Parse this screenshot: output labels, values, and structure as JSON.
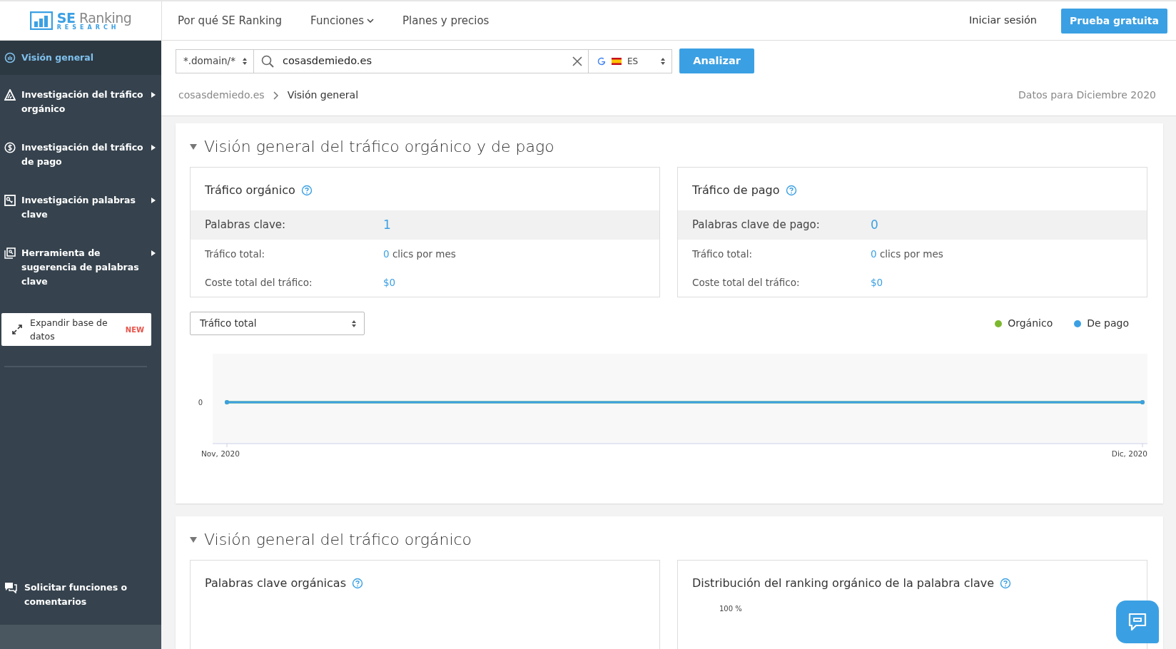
{
  "logo": {
    "name": "SE Ranking",
    "sub": "RESEARCH"
  },
  "sidebar": {
    "items": [
      {
        "label": "Visión general",
        "selected": true,
        "expandable": false
      },
      {
        "label": "Investigación del tráfico orgánico",
        "selected": false,
        "expandable": true
      },
      {
        "label": "Investigación del tráfico de pago",
        "selected": false,
        "expandable": true
      },
      {
        "label": "Investigación palabras clave",
        "selected": false,
        "expandable": true
      },
      {
        "label": "Herramienta de sugerencia de palabras clave",
        "selected": false,
        "expandable": true
      }
    ],
    "expand_button": {
      "label": "Expandir base de datos",
      "badge": "NEW"
    },
    "feedback": "Solicitar funciones o comentarios"
  },
  "nav": {
    "links": [
      {
        "label": "Por qué SE Ranking",
        "dropdown": false
      },
      {
        "label": "Funciones",
        "dropdown": true
      },
      {
        "label": "Planes y precios",
        "dropdown": false
      }
    ],
    "login": "Iniciar sesión",
    "trial": "Prueba gratuita"
  },
  "search": {
    "mode": "*.domain/*",
    "value": "cosasdemiedo.es",
    "country": "ES",
    "button": "Analizar"
  },
  "breadcrumb": {
    "items": [
      "cosasdemiedo.es",
      "Visión general"
    ],
    "date_note": "Datos para Diciembre 2020"
  },
  "section1": {
    "title": "Visión general del tráfico orgánico y de pago",
    "cards": [
      {
        "title": "Tráfico orgánico",
        "rows": [
          {
            "label": "Palabras clave:",
            "value": "1",
            "suffix": "",
            "highlight": true
          },
          {
            "label": "Tráfico total:",
            "value": "0",
            "suffix": " clics por mes",
            "highlight": false
          },
          {
            "label": "Coste total del tráfico:",
            "value": "$0",
            "suffix": "",
            "highlight": false
          }
        ]
      },
      {
        "title": "Tráfico de pago",
        "rows": [
          {
            "label": "Palabras clave de pago:",
            "value": "0",
            "suffix": "",
            "highlight": true
          },
          {
            "label": "Tráfico total:",
            "value": "0",
            "suffix": " clics por mes",
            "highlight": false
          },
          {
            "label": "Coste total del tráfico:",
            "value": "$0",
            "suffix": "",
            "highlight": false
          }
        ]
      }
    ],
    "metric_select": "Tráfico total",
    "legend": [
      {
        "name": "Orgánico",
        "color": "#7cb82f"
      },
      {
        "name": "De pago",
        "color": "#3ba0e3"
      }
    ],
    "chart": {
      "y_tick": "0",
      "x_labels": [
        "Nov, 2020",
        "Dic, 2020"
      ]
    }
  },
  "section2": {
    "title": "Visión general del tráfico orgánico",
    "cards": [
      {
        "title": "Palabras clave orgánicas"
      },
      {
        "title": "Distribución del ranking orgánico de la palabra clave",
        "axis_label": "100 %"
      }
    ]
  }
}
